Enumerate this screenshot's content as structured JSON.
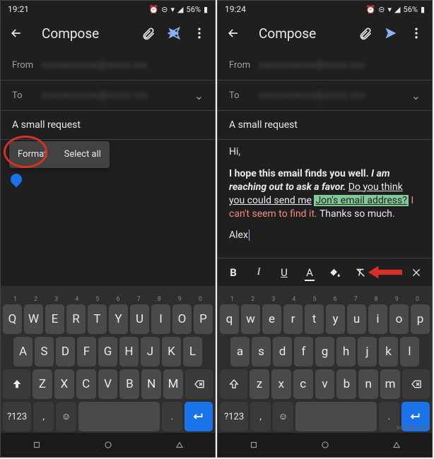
{
  "left": {
    "status": {
      "time": "19:21",
      "battery": "56%"
    },
    "appbar": {
      "title": "Compose"
    },
    "from_label": "From",
    "from_value": "xxxxxxxxxxxx@xxxxx.xxx",
    "to_label": "To",
    "to_value": "xxxxxxxxxxxx@xxxxx.xxx",
    "subject": "A small request",
    "context_menu": {
      "format": "Format",
      "select_all": "Select all"
    },
    "keyboard": {
      "hints": [
        "1",
        "2",
        "3",
        "4",
        "5",
        "6",
        "7",
        "8",
        "9",
        "0"
      ],
      "row1": [
        "Q",
        "W",
        "E",
        "R",
        "T",
        "Y",
        "U",
        "I",
        "O",
        "P"
      ],
      "row2": [
        "A",
        "S",
        "D",
        "F",
        "G",
        "H",
        "J",
        "K",
        "L"
      ],
      "row3": [
        "Z",
        "X",
        "C",
        "V",
        "B",
        "N",
        "M"
      ],
      "sym": "?123",
      "comma": ",",
      "period": "."
    }
  },
  "right": {
    "status": {
      "time": "19:24",
      "battery": "56%"
    },
    "appbar": {
      "title": "Compose"
    },
    "from_label": "From",
    "from_value": "xxxxxxxxxxxx@xxxxx.xxx",
    "to_label": "To",
    "to_value": "xxxxxxxxxxxx@xxxxx.xxx",
    "subject": "A small request",
    "body": {
      "greet": "Hi,",
      "l1a": "I hope this email finds you well.",
      "l1b": "I am reaching out to ask a favor.",
      "l2a": "Do you think you could send me",
      "l2b": "Jon's email address?",
      "l2c": "I can't seem to find it.",
      "l2d": "Thanks so much.",
      "sig": "Alex"
    },
    "format_bar": {
      "b": "B",
      "i": "I",
      "u": "U",
      "a": "A"
    },
    "keyboard": {
      "hints": [
        "1",
        "2",
        "3",
        "4",
        "5",
        "6",
        "7",
        "8",
        "9",
        "0"
      ],
      "row1": [
        "q",
        "w",
        "e",
        "r",
        "t",
        "y",
        "u",
        "i",
        "o",
        "p"
      ],
      "row2": [
        "a",
        "s",
        "d",
        "f",
        "g",
        "h",
        "j",
        "k",
        "l"
      ],
      "row3": [
        "z",
        "x",
        "c",
        "v",
        "b",
        "n",
        "m"
      ],
      "sym": "?123",
      "comma": ",",
      "period": "."
    }
  },
  "watermark": "wsxdn.com"
}
